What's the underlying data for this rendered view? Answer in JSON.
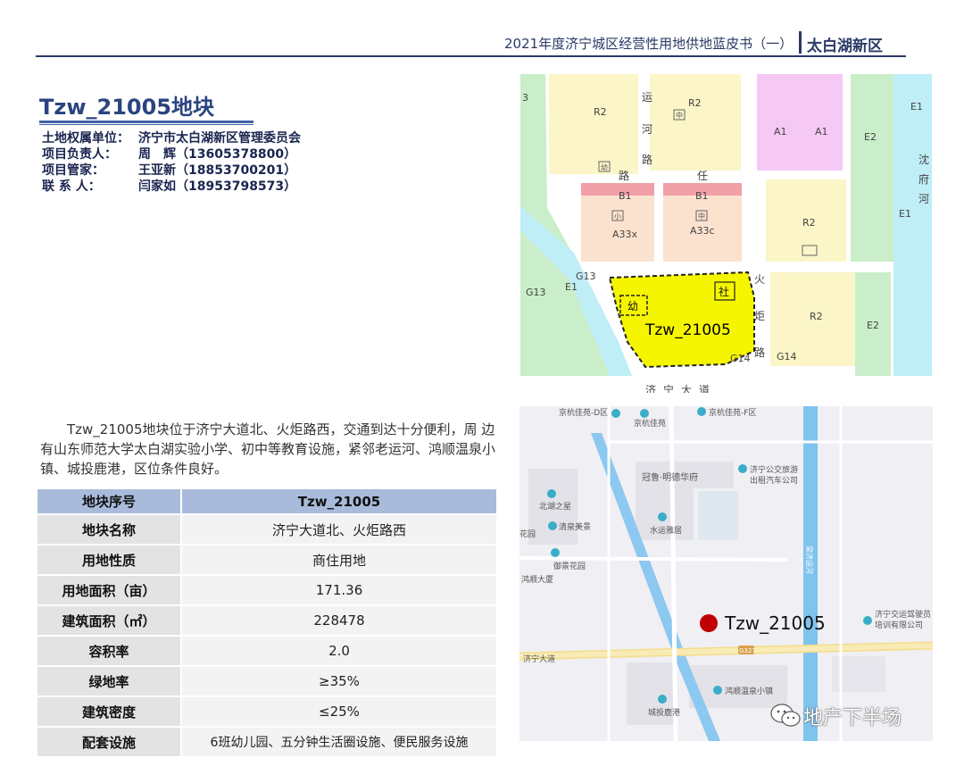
{
  "header": {
    "doc_title": "2021年度济宁城区经营性用地供地蓝皮书（一）",
    "region": "太白湖新区"
  },
  "parcel": {
    "title": "Tzw_21005地块",
    "contacts": [
      {
        "label": "土地权属单位：",
        "value": "济宁市太白湖新区管理委员会"
      },
      {
        "label": "项目负责人：",
        "value": "周　辉（13605378800）"
      },
      {
        "label": "项目管家：",
        "value": "王亚新（18853700201）"
      },
      {
        "label": "联 系 人：",
        "value": "闫家如（18953798573）"
      }
    ],
    "description": "Tzw_21005地块位于济宁大道北、火炬路西，交通到达十分便利，周 边有山东师范大学太白湖实验小学、初中等教育设施，紧邻老运河、鸿顺温泉小镇、城投鹿港，区位条件良好。"
  },
  "table": {
    "header": {
      "label": "地块序号",
      "value": "Tzw_21005"
    },
    "rows": [
      {
        "label": "地块名称",
        "value": "济宁大道北、火炬路西"
      },
      {
        "label": "用地性质",
        "value": "商住用地"
      },
      {
        "label": "用地面积（亩）",
        "value": "171.36"
      },
      {
        "label": "建筑面积（㎡）",
        "value": "228478"
      },
      {
        "label": "容积率",
        "value": "2.0"
      },
      {
        "label": "绿地率",
        "value": "≥35%"
      },
      {
        "label": "建筑密度",
        "value": "≤25%"
      },
      {
        "label": "配套设施",
        "value": "6班幼儿园、五分钟生活圈设施、便民服务设施"
      }
    ]
  },
  "plan_map": {
    "zone_labels": {
      "r2_a": "R2",
      "r2_b": "R2",
      "a1_a": "A1",
      "a1_b": "A1",
      "e2_top": "E2",
      "e1_top": "E1",
      "b1_a": "B1",
      "b1_b": "B1",
      "a33x": "A33x",
      "a33c": "A33c",
      "r2_c": "R2",
      "e1_right": "E1",
      "g13_a": "G13",
      "e1_left": "E1",
      "g13_b": "G13",
      "r2_d": "R2",
      "e2_bottom": "E2",
      "g14_a": "G14",
      "g14_b": "G14",
      "e3": "3",
      "kindergarten": "幼",
      "community": "社",
      "kinder_small": "幼",
      "school_small": "中",
      "school_small2": "中",
      "school_small3": "小",
      "road_huoju_1": "火",
      "road_huoju_2": "炬",
      "road_huoju_3": "路",
      "road_he": "河",
      "road_lu": "路",
      "road_jiu": "济",
      "road_ning": "宁",
      "road_da": "大",
      "road_dao": "道",
      "road_yun": "运",
      "road_ren": "任",
      "road_luu": "路",
      "road_xiang": "沈",
      "road_fu": "府",
      "road_he2": "河"
    },
    "parcel_label": "Tzw_21005"
  },
  "location_map": {
    "pois": [
      {
        "name": "京杭佳苑-D区"
      },
      {
        "name": "京杭佳苑"
      },
      {
        "name": "京杭佳苑-F区"
      },
      {
        "name": "冠鲁·明德华府"
      },
      {
        "name": "济宁公交旅游"
      },
      {
        "name": "出租汽车公司"
      },
      {
        "name": "北湖之星"
      },
      {
        "name": "清泉美景"
      },
      {
        "name": "水运雅居"
      },
      {
        "name": "御景花园"
      },
      {
        "name": "鸿顺大厦"
      },
      {
        "name": "济宁交运驾驶员"
      },
      {
        "name": "培训有限公司"
      },
      {
        "name": "济宁大道"
      },
      {
        "name": "鸿顺温泉小镇"
      },
      {
        "name": "城投鹿港"
      },
      {
        "name": "梁济运河"
      },
      {
        "name": "G327"
      },
      {
        "name": "花园"
      }
    ],
    "marker_label": "Tzw_21005",
    "marker_color": "#c00000"
  },
  "watermark": {
    "text": "地产下半场"
  },
  "colors": {
    "accent": "#2b3a66",
    "parcel_fill": "#f5f500",
    "residential": "#fbf5c8",
    "greenspace": "#c9eec9",
    "water": "#bfeef7"
  }
}
